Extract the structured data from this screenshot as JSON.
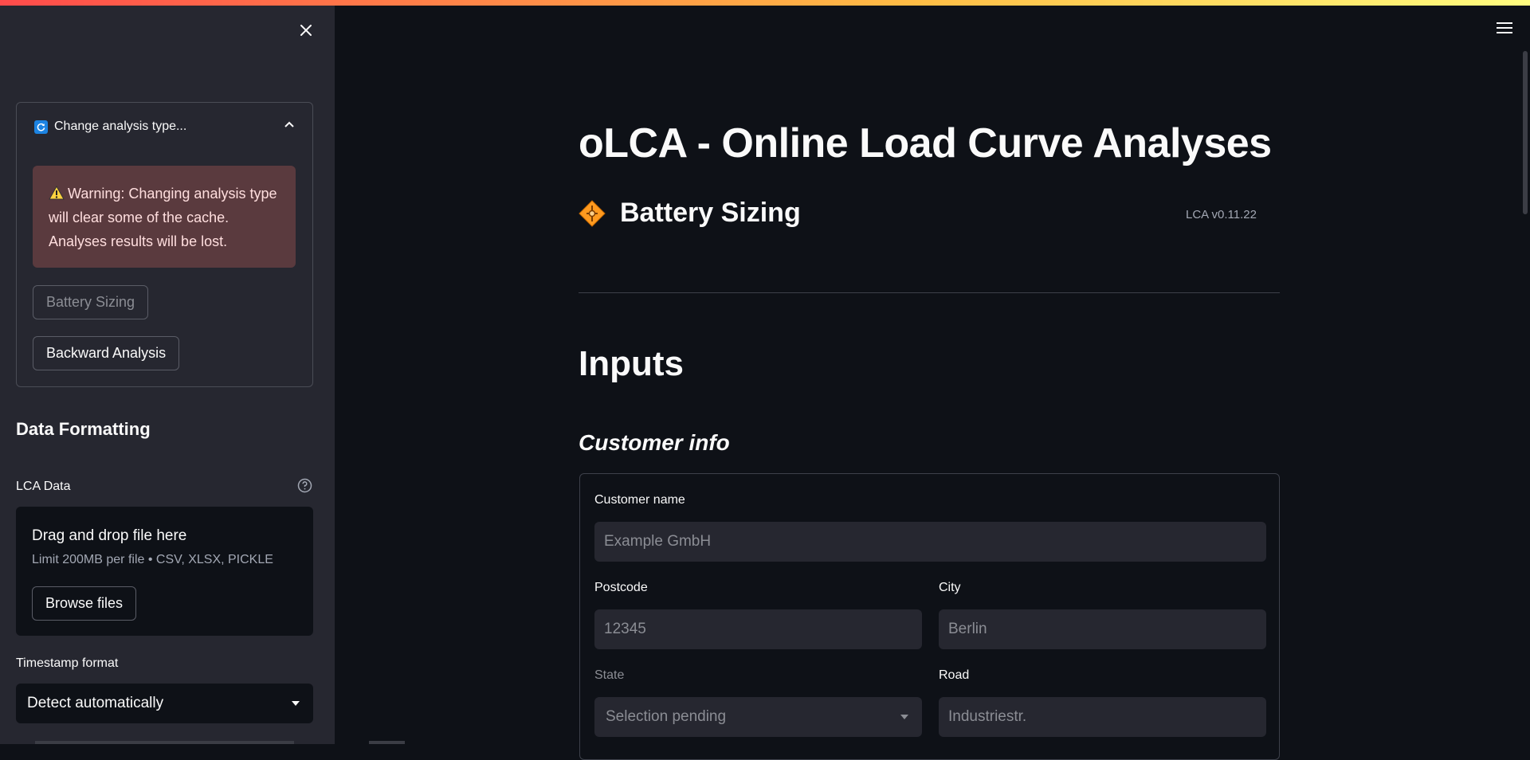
{
  "sidebar": {
    "close_icon": "close-icon",
    "expander": {
      "title": "Change analysis type...",
      "icon": "refresh-icon",
      "warning_icon": "warning-icon",
      "warning": "Warning: Changing analysis type will clear some of the cache. Analyses results will be lost.",
      "buttons": [
        "Battery Sizing",
        "Backward Analysis"
      ]
    },
    "section_heading": "Data Formatting",
    "upload": {
      "label": "LCA Data",
      "drop_title": "Drag and drop file here",
      "drop_limit": "Limit 200MB per file • CSV, XLSX, PICKLE",
      "browse_label": "Browse files"
    },
    "timestamp": {
      "label": "Timestamp format",
      "value": "Detect automatically"
    }
  },
  "main": {
    "title": "oLCA - Online Load Curve Analyses",
    "subtitle": "Battery Sizing",
    "version": "LCA v0.11.22",
    "inputs_heading": "Inputs",
    "customer_heading": "Customer info",
    "form": {
      "customer_name": {
        "label": "Customer name",
        "placeholder": "Example GmbH"
      },
      "postcode": {
        "label": "Postcode",
        "placeholder": "12345"
      },
      "city": {
        "label": "City",
        "placeholder": "Berlin"
      },
      "state": {
        "label": "State",
        "value": "Selection pending"
      },
      "road": {
        "label": "Road",
        "placeholder": "Industriestr."
      }
    }
  },
  "colors": {
    "background": "#0e1117",
    "sidebar": "#262730",
    "accent": "#ff4b4b",
    "warning_bg": "#5a3a3e",
    "icon_orange": "#ff9a1f"
  }
}
